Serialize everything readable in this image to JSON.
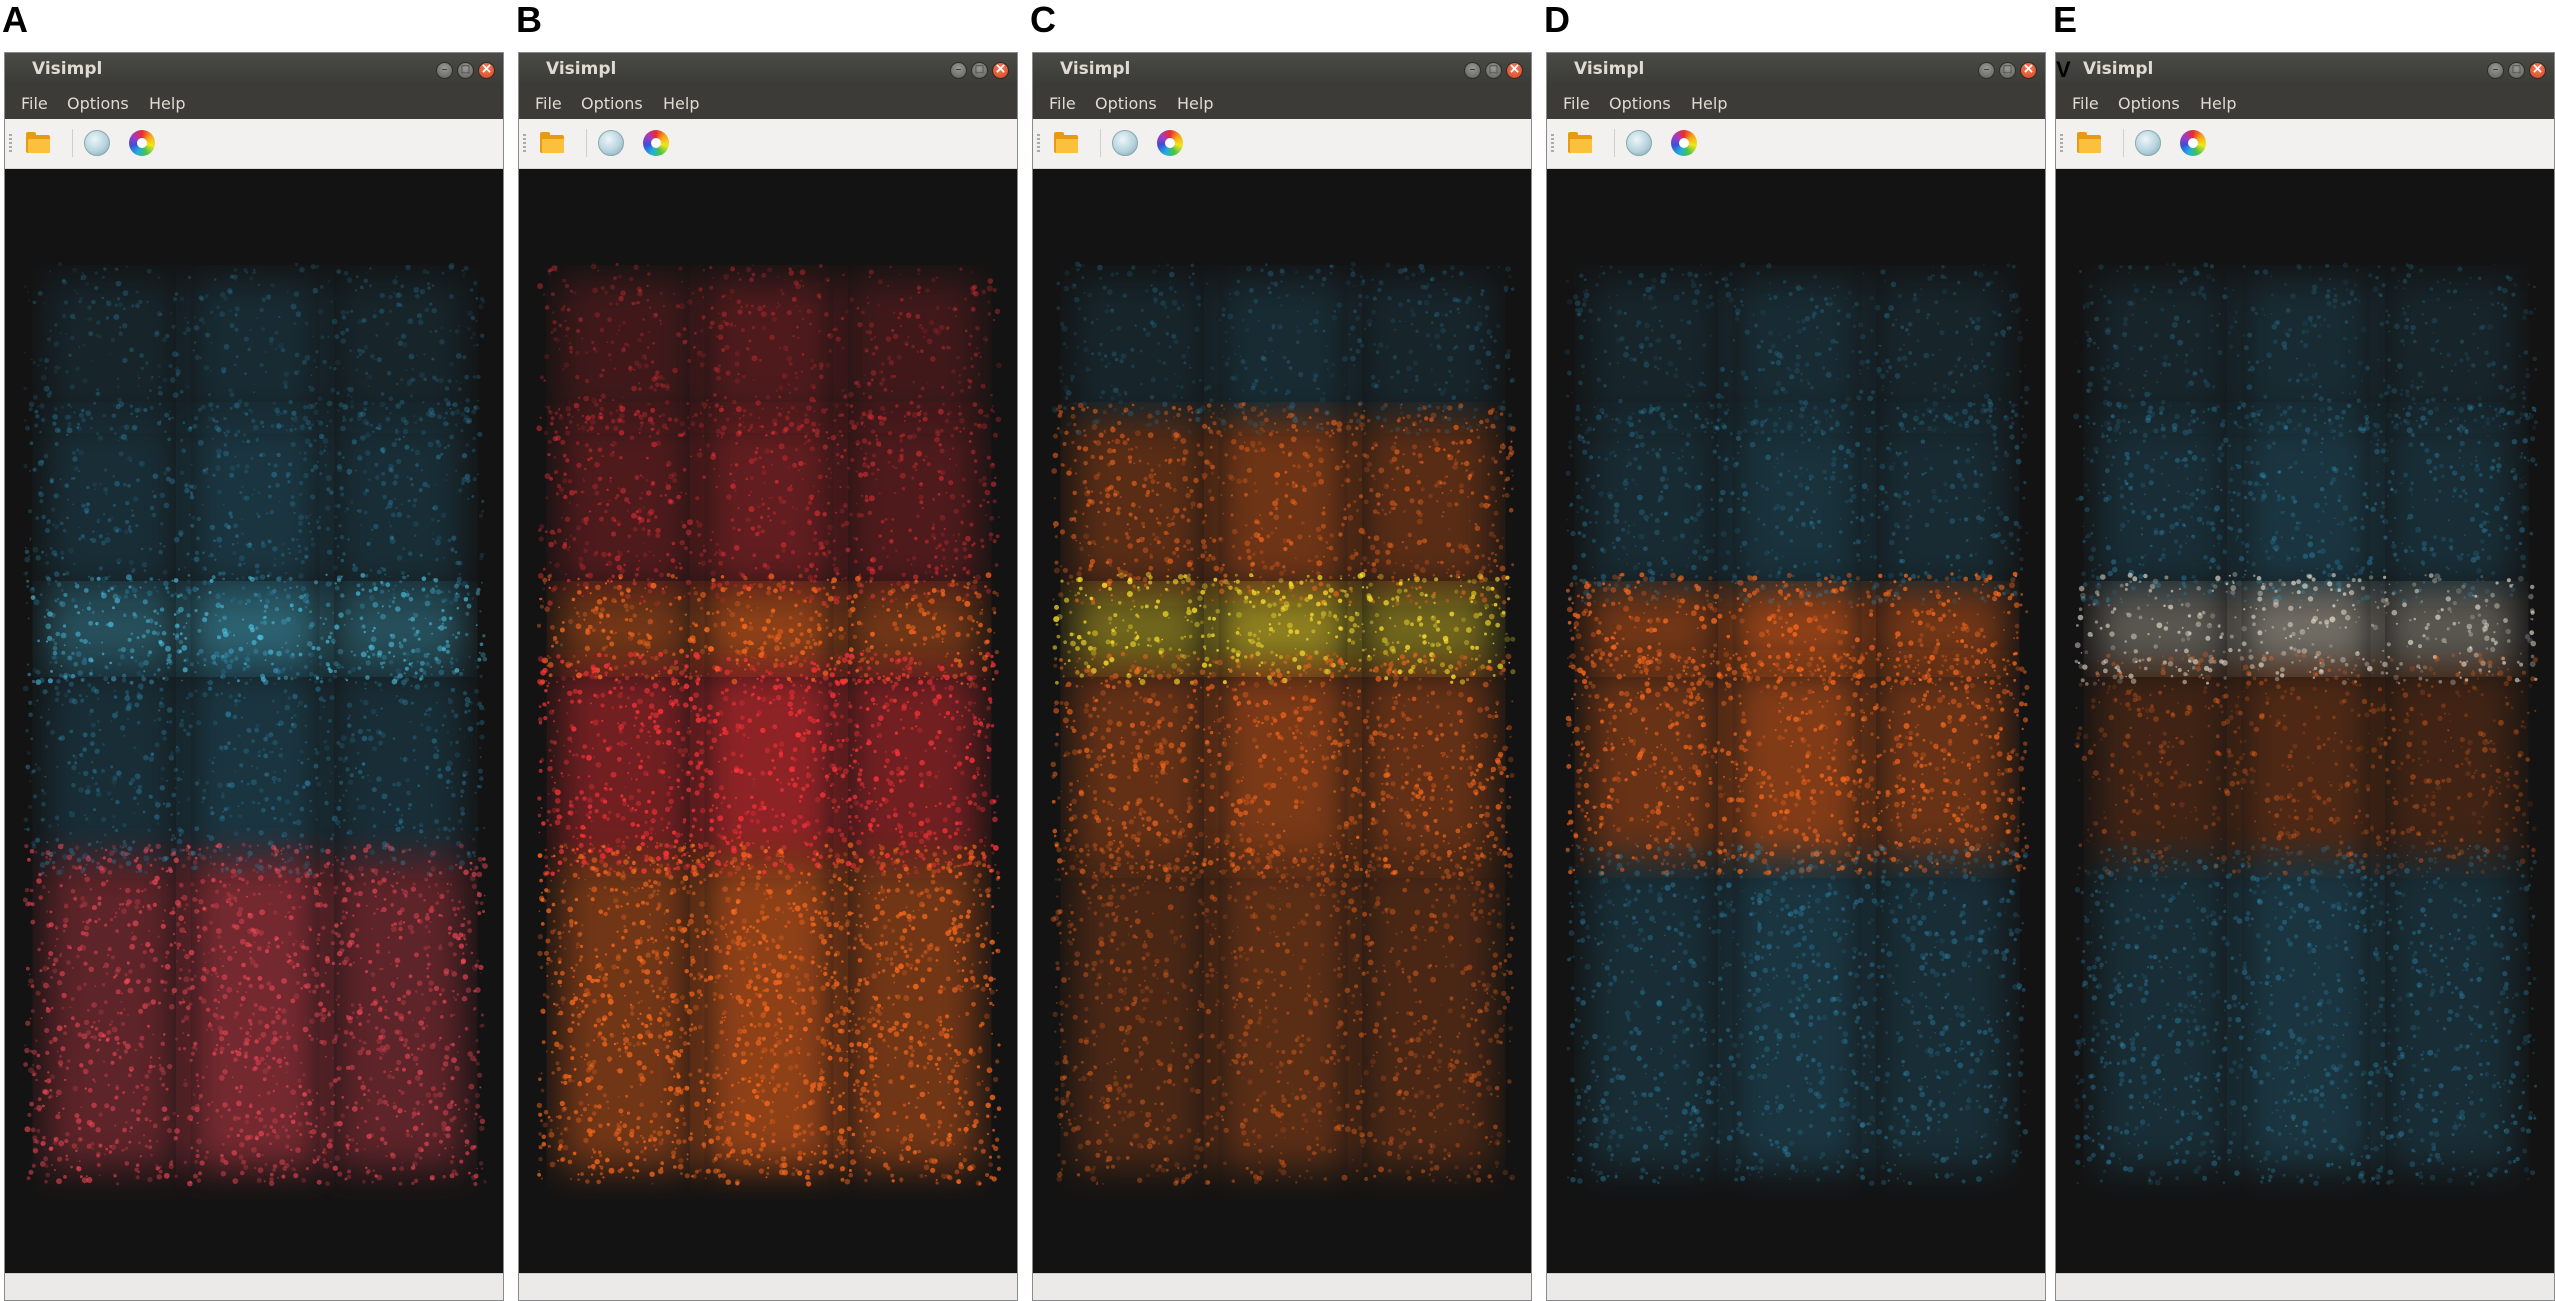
{
  "panels": [
    {
      "letter": "A",
      "title": "Visimpl",
      "menu": [
        "File",
        "Options",
        "Help"
      ],
      "scheme": "A"
    },
    {
      "letter": "B",
      "title": "Visimpl",
      "menu": [
        "File",
        "Options",
        "Help"
      ],
      "scheme": "B"
    },
    {
      "letter": "C",
      "title": "Visimpl",
      "menu": [
        "File",
        "Options",
        "Help"
      ],
      "scheme": "C"
    },
    {
      "letter": "D",
      "title": "Visimpl",
      "menu": [
        "File",
        "Options",
        "Help"
      ],
      "scheme": "D"
    },
    {
      "letter": "E",
      "title": "Visimpl",
      "menu": [
        "File",
        "Options",
        "Help"
      ],
      "scheme": "E",
      "stray": "V"
    }
  ],
  "colors": {
    "cyan": "#2f8fb8",
    "brightCyan": "#4ec7ea",
    "red": "#ff3338",
    "orange": "#ff6a1c",
    "yellow": "#ffe22b",
    "pink": "#ff4a5a",
    "cream": "#f6ecd8",
    "background": "#131313"
  },
  "icons": {
    "open": "folder-icon",
    "sphere": "sphere-icon",
    "colors": "color-wheel-icon"
  }
}
